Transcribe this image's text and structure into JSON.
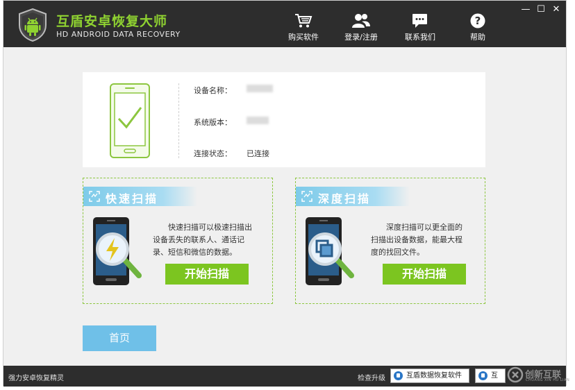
{
  "app": {
    "title_cn": "互盾安卓恢复大师",
    "title_en": "HD ANDROID DATA RECOVERY"
  },
  "nav": [
    {
      "label": "购买软件",
      "icon": "cart-icon"
    },
    {
      "label": "登录/注册",
      "icon": "user-icon"
    },
    {
      "label": "联系我们",
      "icon": "chat-icon"
    },
    {
      "label": "帮助",
      "icon": "help-icon"
    }
  ],
  "window": {
    "minimize": "—",
    "maximize": "☐",
    "close": "✕"
  },
  "device": {
    "name_label": "设备名称：",
    "version_label": "系统版本：",
    "status_label": "连接状态：",
    "status_value": "已连接"
  },
  "quick_scan": {
    "title": "快速扫描",
    "description": "快速扫描可以极速扫描出设备丢失的联系人、通话记录、短信和微信的数据。",
    "desc_lines": [
      "快速扫描可以极速扫描出",
      "设备丢失的联系人、通话记",
      "录、短信和微信的数据。"
    ],
    "button": "开始扫描"
  },
  "deep_scan": {
    "title": "深度扫描",
    "description": "深度扫描可以更全面的扫描出设备数据，能最大程度的找回文件。",
    "desc_lines": [
      "深度扫描可以更全面的",
      "扫描出设备数据，能最大程",
      "度的找回文件。"
    ],
    "button": "开始扫描"
  },
  "home_button": "首页",
  "statusbar": {
    "left_text": "强力安卓恢复精灵",
    "upgrade": "检查升级",
    "taskbar_item_1": "互盾数据恢复软件",
    "taskbar_item_2": "互"
  },
  "watermark": {
    "text": "创新互联",
    "sub": "CHUANG XIN HU LIAN"
  },
  "colors": {
    "accent_green": "#7cc520",
    "header_dark": "#2d2d2d",
    "accent_blue": "#6fc0e8",
    "brand_green": "#8fd231"
  }
}
